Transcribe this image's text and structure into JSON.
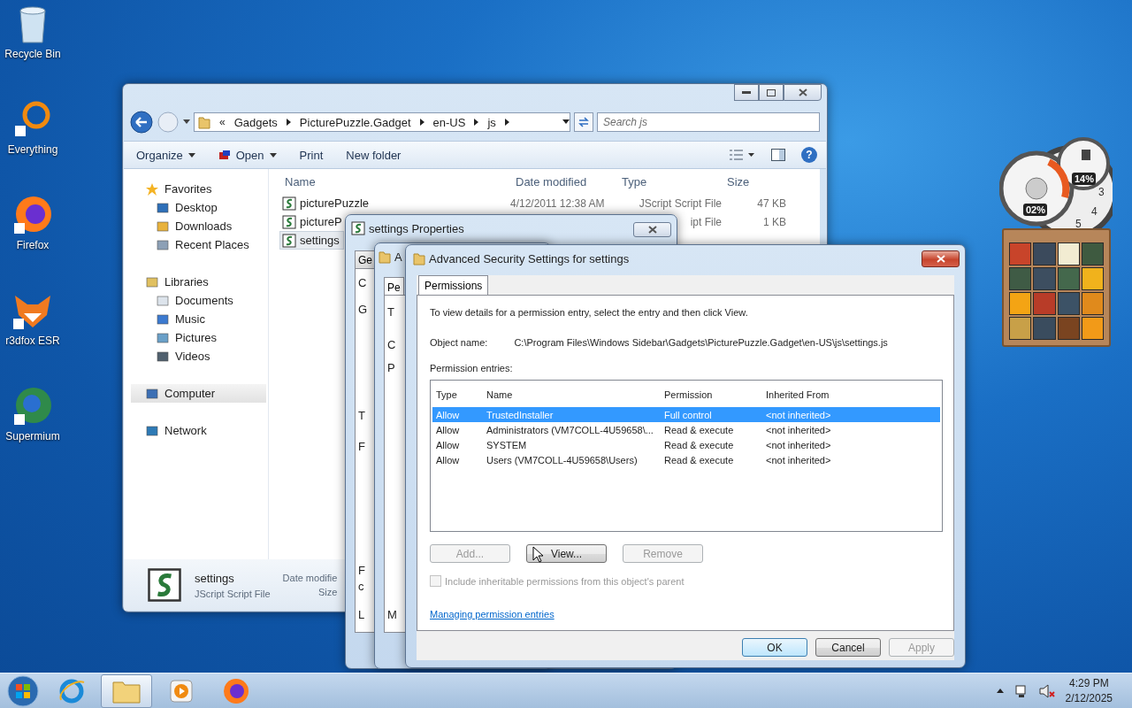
{
  "desktop_icons": [
    {
      "label": "Recycle Bin",
      "kind": "bin"
    },
    {
      "label": "Everything",
      "kind": "search"
    },
    {
      "label": "Firefox",
      "kind": "firefox"
    },
    {
      "label": "r3dfox ESR",
      "kind": "fox"
    },
    {
      "label": "Supermium",
      "kind": "globe"
    }
  ],
  "explorer": {
    "breadcrumb_prefix": "«",
    "breadcrumb": [
      "Gadgets",
      "PicturePuzzle.Gadget",
      "en-US",
      "js"
    ],
    "search": {
      "placeholder": "Search js"
    },
    "toolbar": [
      {
        "label": "Organize",
        "kind": "menu"
      },
      {
        "label": "Open",
        "kind": "open"
      },
      {
        "label": "Print",
        "kind": "plain"
      },
      {
        "label": "New folder",
        "kind": "plain"
      }
    ],
    "help": "?",
    "nav": [
      {
        "label": "Favorites",
        "selected": false,
        "children": [
          {
            "label": "Desktop",
            "selected": false
          },
          {
            "label": "Downloads",
            "selected": false
          },
          {
            "label": "Recent Places",
            "selected": false
          }
        ]
      },
      {
        "label": "Libraries",
        "selected": false,
        "children": [
          {
            "label": "Documents",
            "selected": false
          },
          {
            "label": "Music",
            "selected": false
          },
          {
            "label": "Pictures",
            "selected": false
          },
          {
            "label": "Videos",
            "selected": false
          }
        ]
      },
      {
        "label": "Computer",
        "selected": true
      },
      {
        "label": "Network",
        "selected": false
      }
    ],
    "columns": [
      "Name",
      "Date modified",
      "Type",
      "Size"
    ],
    "files": [
      {
        "name": "picturePuzzle",
        "date": "4/12/2011 12:38 AM",
        "type": "JScript Script File",
        "size": "47 KB",
        "selected": false
      },
      {
        "name": "pictureP",
        "type": "ipt File",
        "size": "1 KB",
        "selected": false
      },
      {
        "name": "settings",
        "selected": true
      }
    ],
    "details": {
      "name": "settings",
      "type": "JScript Script File",
      "date_label": "Date modifie",
      "size_label": "Size"
    }
  },
  "properties_dialog": {
    "title": "settings Properties",
    "tab": "Ge",
    "fragments": [
      "C",
      "G",
      "T",
      "F",
      "F",
      "c",
      "L"
    ]
  },
  "middle_dialog": {
    "title": "A",
    "tab": "Pe",
    "fragments": [
      "T",
      "C",
      "P",
      "M"
    ]
  },
  "advanced_dialog": {
    "title": "Advanced Security Settings for settings",
    "tabs": [
      {
        "label": "Permissions",
        "selected": true
      }
    ],
    "intro": "To view details for a permission entry, select the entry and then click View.",
    "object_label": "Object name:",
    "object_value": "C:\\Program Files\\Windows Sidebar\\Gadgets\\PicturePuzzle.Gadget\\en-US\\js\\settings.js",
    "entries_label": "Permission entries:",
    "columns": [
      "Type",
      "Name",
      "Permission",
      "Inherited From"
    ],
    "entries": [
      {
        "type": "Allow",
        "name": "TrustedInstaller",
        "permission": "Full control",
        "inherited": "<not inherited>",
        "selected": true
      },
      {
        "type": "Allow",
        "name": "Administrators (VM7COLL-4U59658\\...",
        "permission": "Read & execute",
        "inherited": "<not inherited>",
        "selected": false
      },
      {
        "type": "Allow",
        "name": "SYSTEM",
        "permission": "Read & execute",
        "inherited": "<not inherited>",
        "selected": false
      },
      {
        "type": "Allow",
        "name": "Users (VM7COLL-4U59658\\Users)",
        "permission": "Read & execute",
        "inherited": "<not inherited>",
        "selected": false
      }
    ],
    "entry_buttons": [
      {
        "label": "Add...",
        "disabled": true
      },
      {
        "label": "View...",
        "disabled": false
      },
      {
        "label": "Remove",
        "disabled": true
      }
    ],
    "inherit_checkbox": {
      "label": "Include inheritable permissions from this object's parent",
      "checked": false,
      "disabled": true
    },
    "link": "Managing permission entries",
    "footer_buttons": [
      {
        "label": "OK",
        "disabled": false,
        "default": true
      },
      {
        "label": "Cancel",
        "disabled": false,
        "default": false
      },
      {
        "label": "Apply",
        "disabled": true,
        "default": false
      }
    ]
  },
  "gadgets": {
    "cpu": "02%",
    "memory": "14%",
    "clock_numbers": [
      "3",
      "4",
      "5"
    ],
    "tiles": [
      {
        "color": "#c8442a"
      },
      {
        "color": "#3b4a5c"
      },
      {
        "color": "#f2ecd2"
      },
      {
        "color": "#3e5a40"
      },
      {
        "color": "#3f5b45"
      },
      {
        "color": "#3d4e60"
      },
      {
        "color": "#44684c"
      },
      {
        "color": "#f0b21c"
      },
      {
        "color": "#f4a414"
      },
      {
        "color": "#b83c28"
      },
      {
        "color": "#3c5266"
      },
      {
        "color": "#e08a1c"
      },
      {
        "color": "#c8a048"
      },
      {
        "color": "#3a4c5e"
      },
      {
        "color": "#7a4420"
      },
      {
        "color": "#f29a18"
      }
    ]
  },
  "taskbar": {
    "apps": [
      {
        "kind": "ie",
        "selected": false
      },
      {
        "kind": "explorer",
        "selected": true
      },
      {
        "kind": "media",
        "selected": false
      },
      {
        "kind": "firefox",
        "selected": false
      }
    ],
    "time": "4:29 PM",
    "date": "2/12/2025"
  }
}
